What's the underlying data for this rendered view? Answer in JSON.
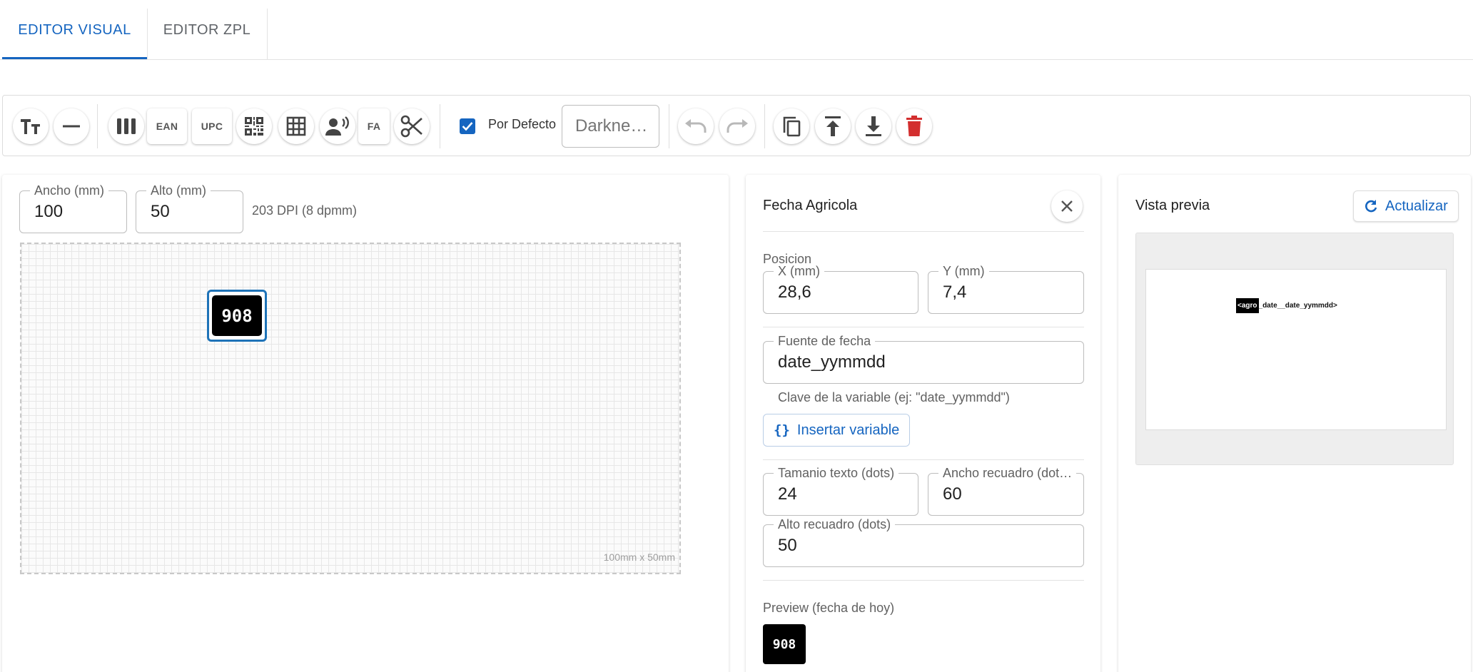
{
  "tabs": [
    {
      "label": "EDITOR VISUAL",
      "active": true
    },
    {
      "label": "EDITOR ZPL",
      "active": false
    }
  ],
  "toolbar": {
    "buttons": [
      {
        "name": "text-button",
        "icon": "text-fields-icon"
      },
      {
        "name": "line-button",
        "icon": "horizontal-rule-icon"
      },
      {
        "name": "barcode-button",
        "icon": "barcode-icon"
      },
      {
        "name": "ean-button",
        "label": "EAN"
      },
      {
        "name": "upc-button",
        "label": "UPC"
      },
      {
        "name": "qr-button",
        "icon": "qr-code-icon"
      },
      {
        "name": "table-button",
        "icon": "grid-icon"
      },
      {
        "name": "speech-button",
        "icon": "person-voice-icon"
      },
      {
        "name": "fa-button",
        "label": "FA"
      },
      {
        "name": "cut-button",
        "icon": "scissors-icon"
      }
    ],
    "default_checkbox": {
      "label": "Por Defecto",
      "checked": true
    },
    "darkness_placeholder": "Darkne…",
    "actions": [
      {
        "name": "undo-button",
        "icon": "undo-icon",
        "enabled": false
      },
      {
        "name": "redo-button",
        "icon": "redo-icon",
        "enabled": false
      },
      {
        "name": "copy-button",
        "icon": "copy-icon"
      },
      {
        "name": "upload-button",
        "icon": "upload-icon"
      },
      {
        "name": "download-button",
        "icon": "download-icon"
      },
      {
        "name": "delete-button",
        "icon": "trash-icon",
        "color": "#d32f2f"
      }
    ]
  },
  "canvas_panel": {
    "width_label": "Ancho (mm)",
    "width_value": "100",
    "height_label": "Alto (mm)",
    "height_value": "50",
    "dpi_text": "203 DPI (8 dpmm)",
    "size_note": "100mm x 50mm",
    "element_text": "908"
  },
  "properties": {
    "title": "Fecha Agricola",
    "position_label": "Posicion",
    "x_label": "X (mm)",
    "x_value": "28,6",
    "y_label": "Y (mm)",
    "y_value": "7,4",
    "source_label": "Fuente de fecha",
    "source_value": "date_yymmdd",
    "source_help": "Clave de la variable (ej: \"date_yymmdd\")",
    "insert_variable": "Insertar variable",
    "text_size_label": "Tamanio texto (dots)",
    "text_size_value": "24",
    "box_width_label": "Ancho recuadro (dot…",
    "box_width_value": "60",
    "box_height_label": "Alto recuadro (dots)",
    "box_height_value": "50",
    "preview_label": "Preview (fecha de hoy)",
    "preview_value": "908"
  },
  "preview_panel": {
    "title": "Vista previa",
    "refresh_label": "Actualizar",
    "label_tag": "<agro",
    "label_text": "_date__date_yymmdd>"
  },
  "colors": {
    "accent": "#1565c0",
    "delete": "#d32f2f"
  }
}
